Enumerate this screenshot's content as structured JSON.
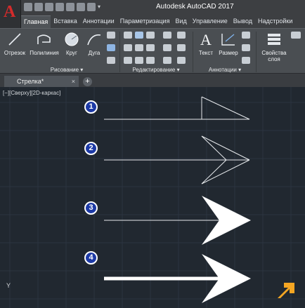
{
  "app": {
    "title": "Autodesk AutoCAD 2017",
    "logo_letter": "A"
  },
  "quick_access": {
    "icons": [
      "new-icon",
      "open-icon",
      "save-icon",
      "save-as-icon",
      "print-icon",
      "undo-icon",
      "redo-icon",
      "dropdown-icon"
    ]
  },
  "tabs": [
    "Главная",
    "Вставка",
    "Аннотации",
    "Параметризация",
    "Вид",
    "Управление",
    "Вывод",
    "Надстройки"
  ],
  "ribbon": {
    "draw": {
      "line": "Отрезок",
      "polyline": "Полилиния",
      "circle": "Круг",
      "arc": "Дуга",
      "label": "Рисование ▾"
    },
    "modify": {
      "label": "Редактирование ▾"
    },
    "annotation": {
      "text": "Текст",
      "dimension": "Размер",
      "label": "Аннотации ▾"
    },
    "layers": {
      "properties_line1": "Свойства",
      "properties_line2": "слоя"
    }
  },
  "document": {
    "tab_label": "Стрелка*",
    "close": "×",
    "new_tab": "+"
  },
  "viewport": {
    "label": "[−][Сверху][2D-каркас]",
    "ucs_y": "Y"
  },
  "annotations": [
    "1",
    "2",
    "3",
    "4"
  ],
  "colors": {
    "canvas": "#212830",
    "badge": "#1d3aa6",
    "accent_logo": "#f5a623"
  }
}
